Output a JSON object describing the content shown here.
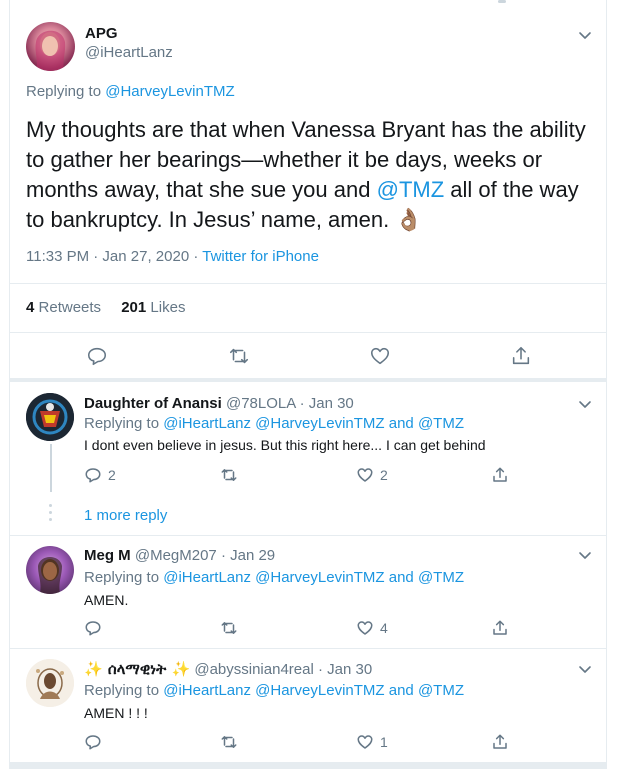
{
  "main_tweet": {
    "name": "APG",
    "handle": "@iHeartLanz",
    "replying_prefix": "Replying to",
    "replying_to": "@HarveyLevinTMZ",
    "text_part1": "My thoughts are that when Vanessa Bryant has the ability to gather her bearings—whether it be days, weeks or months away, that she sue you and",
    "mention": "@TMZ",
    "text_part2": "all of the way to bankruptcy. In Jesus’ name, amen.",
    "emoji": "👌🏽",
    "time": "11:33 PM · Jan 27, 2020 ·",
    "source": "Twitter for iPhone",
    "retweets_count": "4",
    "retweets_label": "Retweets",
    "likes_count": "201",
    "likes_label": "Likes"
  },
  "replies": [
    {
      "name": "Daughter of Anansi",
      "handle_date": "@78LOLA · Jan 30",
      "replying_prefix": "Replying to",
      "replying_to": "@iHeartLanz @HarveyLevinTMZ",
      "and_text": "and",
      "replying_tmz": "@TMZ",
      "text": "I dont even believe in jesus. But this right here... I can get behind",
      "reply_count": "2",
      "retweet_count": "",
      "like_count": "2",
      "more_replies": "1 more reply"
    },
    {
      "name": "Meg M",
      "handle_date": "@MegM207 · Jan 29",
      "replying_prefix": "Replying to",
      "replying_to": "@iHeartLanz @HarveyLevinTMZ",
      "and_text": "and",
      "replying_tmz": "@TMZ",
      "text": "AMEN.",
      "reply_count": "",
      "retweet_count": "",
      "like_count": "4"
    },
    {
      "name": "✨ ሰላማዊነት ✨",
      "handle_date": "@abyssinian4real · Jan 30",
      "replying_prefix": "Replying to",
      "replying_to": "@iHeartLanz @HarveyLevinTMZ",
      "and_text": "and",
      "replying_tmz": "@TMZ",
      "text": "AMEN ! ! !",
      "reply_count": "",
      "retweet_count": "",
      "like_count": "1"
    }
  ],
  "colors": {
    "link": "#1b95e0",
    "muted": "#657786",
    "text": "#14171a",
    "divider": "#e6ecf0"
  },
  "icons": [
    "chevron-down-icon",
    "reply-icon",
    "retweet-icon",
    "like-icon",
    "share-icon"
  ]
}
